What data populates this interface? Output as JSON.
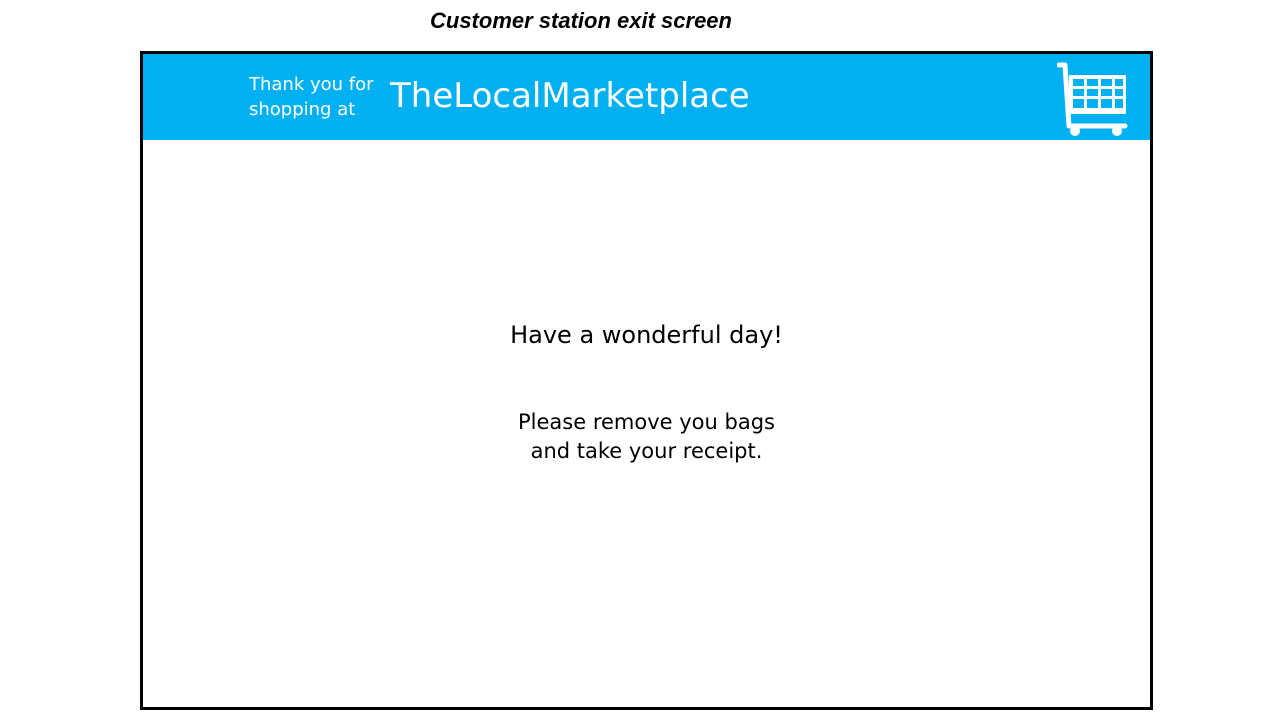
{
  "caption": "Customer station exit screen",
  "header": {
    "thanks_line1": "Thank you for",
    "thanks_line2": "shopping at",
    "store_name": "TheLocalMarketplace",
    "icon": "shopping-cart-icon",
    "background_color": "#00b0f0"
  },
  "main": {
    "greeting": "Have a wonderful day!",
    "instruction_line1": "Please remove you bags",
    "instruction_line2": "and take your receipt."
  }
}
